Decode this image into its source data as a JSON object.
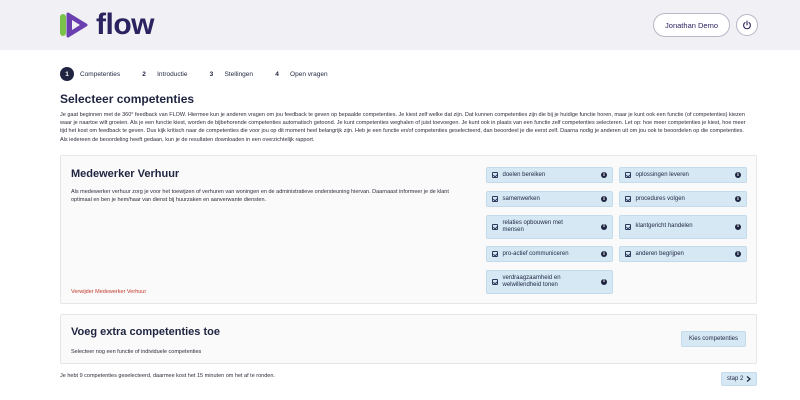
{
  "header": {
    "logo_text": "flow",
    "user_name": "Jonathan Demo",
    "icons": {
      "logout": "power-icon"
    },
    "colors": {
      "brand_dark": "#2a2360",
      "brand_green": "#7bc24a",
      "brand_purple": "#6a3fb0"
    }
  },
  "steps": [
    {
      "num": "1",
      "label": "Competenties"
    },
    {
      "num": "2",
      "label": "Introductie"
    },
    {
      "num": "3",
      "label": "Stellingen"
    },
    {
      "num": "4",
      "label": "Open vragen"
    }
  ],
  "main": {
    "title": "Selecteer competenties",
    "intro": "Je gaat beginnen met de 360° feedback van FLOW. Hiermee kun je anderen vragen om jou feedback te geven op bepaalde competenties. Je kiest zelf welke dat zijn. Dat kunnen competenties zijn die bij je huidige functie horen, maar je kunt ook een functie (of competenties) kiezen waar je naartoe wilt groeien. Als je een functie kiest, worden de bijbehorende competenties automatisch getoond. Je kunt competenties weghalen of juist toevoegen. Je kunt ook in plaats van een functie zelf competenties selecteren. Let op: hoe meer competenties je kiest, hoe meer tijd het kost om feedback te geven. Dus kijk kritisch naar de competenties die voor jou op dit moment heel belangrijk zijn. Heb je een functie en/of competenties geselecteerd, dan beoordeel je die eerst zelf. Daarna nodig je anderen uit om jou ook te beoordelen op die competenties. Als iedereen de beoordeling heeft gedaan, kun je de resultaten downloaden in een overzichtelijk rapport."
  },
  "function_card": {
    "title": "Medewerker Verhuur",
    "description": "Als medewerker verhuur zorg je voor het toewijzen of verhuren van woningen en de administratieve ondersteuning hiervan. Daarnaast informeer je de klant optimaal en ben je hem/haar van dienst bij huurzaken en aanverwante diensten.",
    "remove_label": "Verwijder Medewerker Verhuur",
    "competencies": [
      {
        "label": "doelen bereiken"
      },
      {
        "label": "oplossingen leveren"
      },
      {
        "label": "samenwerken"
      },
      {
        "label": "procedures volgen"
      },
      {
        "label": "relaties opbouwen met mensen"
      },
      {
        "label": "klantgericht handelen"
      },
      {
        "label": "pro-actief communiceren"
      },
      {
        "label": "anderen begrijpen"
      },
      {
        "label": "verdraagzaamheid en welwillendheid tonen"
      }
    ]
  },
  "extra_card": {
    "title": "Voeg extra competenties toe",
    "description": "Selecteer nog een functie of individuele competenties",
    "button_label": "Kies competenties"
  },
  "footer": {
    "summary": "Je hebt 9 competenties geselecteerd, daarmee kost het 15 minuten om het af te ronden.",
    "next_label": "stap 2"
  }
}
